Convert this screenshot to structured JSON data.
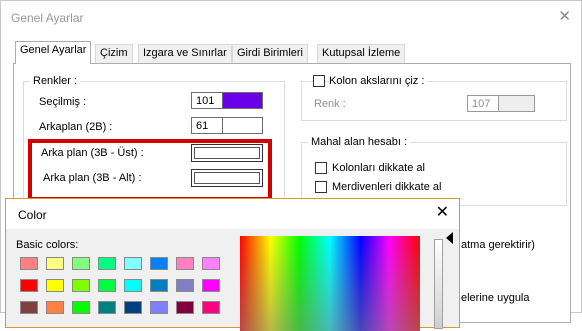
{
  "window": {
    "title": "Genel Ayarlar",
    "close_glyph": "✕"
  },
  "tabs": [
    {
      "label": "Genel Ayarlar",
      "active": true
    },
    {
      "label": "Çizim"
    },
    {
      "label": "Izgara ve Sınırlar"
    },
    {
      "label": "Girdi Birimleri"
    },
    {
      "label": "Kutupsal İzleme"
    }
  ],
  "colors_group": {
    "label": "Renkler :",
    "rows": [
      {
        "label": "Seçilmiş :",
        "value": "101",
        "swatch": "#6a00e8"
      },
      {
        "label": "Arkaplan (2B) :",
        "value": "61",
        "swatch": "#ffffff"
      },
      {
        "label": "Arka plan (3B - Üst) :"
      },
      {
        "label": "Arka plan (3B - Alt) :"
      }
    ]
  },
  "axis_group": {
    "checkbox_label": "Kolon akslarını çiz :",
    "color_label": "Renk :",
    "color_value": "107",
    "swatch": "#eeeeee"
  },
  "area_group": {
    "label": "Mahal alan hesabı :",
    "options": [
      "Kolonları dikkate al",
      "Merdivenleri dikkate al"
    ]
  },
  "partial_texts": {
    "line1": "atma gerektirir)",
    "line2": "elerine uygula"
  },
  "color_dialog": {
    "title": "Color",
    "close_glyph": "✕",
    "basic_label": "Basic colors:",
    "basic_colors": [
      [
        "#ff8080",
        "#ffff80",
        "#80ff80",
        "#00ff80",
        "#80ffff",
        "#0080ff",
        "#ff80c0",
        "#ff80ff"
      ],
      [
        "#ff0000",
        "#ffff00",
        "#80ff00",
        "#00ff40",
        "#00ffff",
        "#0080c0",
        "#8080c0",
        "#ff00ff"
      ],
      [
        "#804040",
        "#ff8040",
        "#00ff00",
        "#008080",
        "#004080",
        "#8080ff",
        "#800040",
        "#ff0080"
      ]
    ]
  }
}
